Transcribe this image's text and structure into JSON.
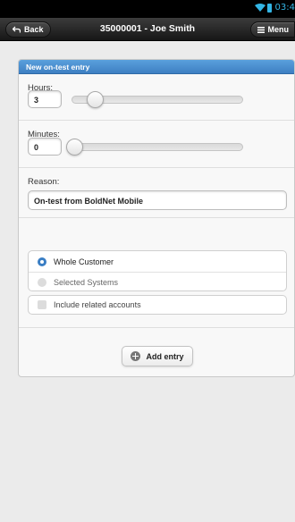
{
  "status_bar": {
    "time": "03:4",
    "accent_color": "#33b5e5",
    "icons": [
      "wifi-icon",
      "battery-icon"
    ]
  },
  "header": {
    "back_label": "Back",
    "back_icon": "back-arrow-icon",
    "title": "35000001 - Joe Smith",
    "menu_label": "Menu",
    "menu_icon": "grid-icon"
  },
  "form": {
    "title": "New on-test entry",
    "hours": {
      "label": "Hours:",
      "value": "3",
      "slider_fraction": 0.08
    },
    "minutes": {
      "label": "Minutes:",
      "value": "0",
      "slider_fraction": 0.0
    },
    "reason": {
      "label": "Reason:",
      "value": "On-test from BoldNet Mobile"
    },
    "scope_options": [
      {
        "label": "Whole Customer",
        "selected": true
      },
      {
        "label": "Selected Systems",
        "selected": false
      }
    ],
    "include_related": {
      "label": "Include related accounts",
      "checked": false
    },
    "add_button": {
      "label": "Add entry",
      "icon": "plus-icon"
    }
  },
  "colors": {
    "card_header": "#4a8fd3",
    "page_background": "#ebebeb",
    "radio_selected": "#3a7ec4"
  }
}
